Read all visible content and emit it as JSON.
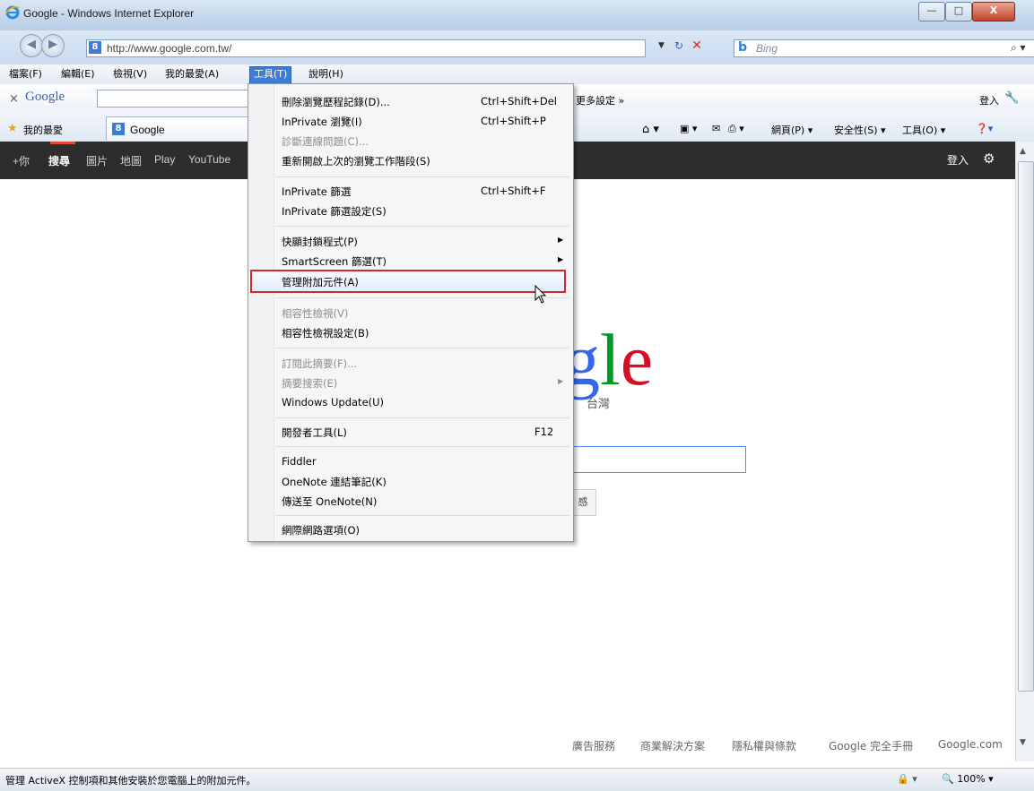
{
  "window": {
    "title": "Google - Windows Internet Explorer",
    "buttons": {
      "minimize": "—",
      "maximize": "□",
      "close": "X"
    }
  },
  "address_bar": {
    "url": "http://www.google.com.tw/",
    "search_placeholder": "Bing"
  },
  "menu_bar": {
    "items": [
      "檔案(F)",
      "編輯(E)",
      "檢視(V)",
      "我的最愛(A)",
      "工具(T)",
      "說明(H)"
    ],
    "active_item": "工具(T)"
  },
  "google_toolbar": {
    "logo": "Google",
    "more_settings": "更多設定 »",
    "signin": "登入"
  },
  "favorites_bar": {
    "favorites_label": "我的最愛",
    "tab_title": "Google",
    "commands": [
      "網頁(P) ▾",
      "安全性(S) ▾",
      "工具(O) ▾"
    ]
  },
  "google_nav": {
    "items": [
      "+你",
      "搜尋",
      "圖片",
      "地圖",
      "Play",
      "YouTube"
    ],
    "selected": "搜尋",
    "signin": "登入"
  },
  "page": {
    "logo_visible": "gle",
    "logo_region": "台灣",
    "search_btn_fragment": "感"
  },
  "footer": {
    "links": [
      "廣告服務",
      "商業解決方案",
      "隱私權與條款",
      "Google 完全手冊",
      "Google.com"
    ]
  },
  "tools_menu": {
    "items": [
      {
        "label": "刪除瀏覽歷程記錄(D)...",
        "shortcut": "Ctrl+Shift+Del"
      },
      {
        "label": "InPrivate 瀏覽(I)",
        "shortcut": "Ctrl+Shift+P"
      },
      {
        "label": "診斷連線問題(C)...",
        "disabled": true
      },
      {
        "label": "重新開啟上次的瀏覽工作階段(S)"
      },
      {
        "label": "InPrivate 篩選",
        "shortcut": "Ctrl+Shift+F"
      },
      {
        "label": "InPrivate 篩選設定(S)"
      },
      {
        "label": "快顯封鎖程式(P)",
        "submenu": true
      },
      {
        "label": "SmartScreen 篩選(T)",
        "submenu": true
      },
      {
        "label": "管理附加元件(A)",
        "highlighted": true
      },
      {
        "label": "相容性檢視(V)",
        "disabled": true
      },
      {
        "label": "相容性檢視設定(B)"
      },
      {
        "label": "訂閱此摘要(F)...",
        "disabled": true
      },
      {
        "label": "摘要搜索(E)",
        "disabled": true,
        "submenu": true
      },
      {
        "label": "Windows Update(U)"
      },
      {
        "label": "開發者工具(L)",
        "shortcut": "F12"
      },
      {
        "label": "Fiddler"
      },
      {
        "label": "OneNote 連結筆記(K)"
      },
      {
        "label": "傳送至 OneNote(N)"
      },
      {
        "label": "網際網路選項(O)"
      }
    ]
  },
  "status_bar": {
    "text": "管理 ActiveX 控制項和其他安裝於您電腦上的附加元件。",
    "zoom": "100%"
  },
  "colors": {
    "menu_highlight_border": "#d9262c",
    "google_bar_bg": "#2d2d2d",
    "active_menu_bg": "#3d7dd6"
  }
}
